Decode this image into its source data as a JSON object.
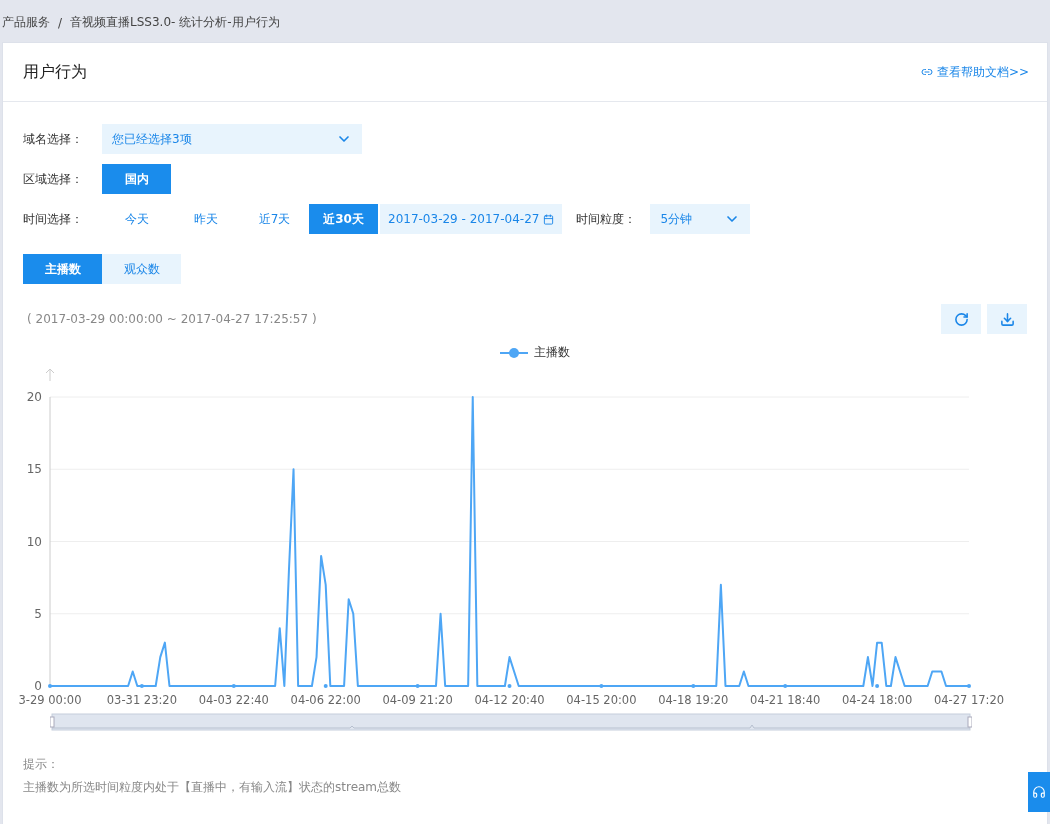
{
  "breadcrumb": {
    "items": [
      "产品服务",
      "音视频直播LSS3.0- 统计分析-用户行为"
    ],
    "separator": "/"
  },
  "title": "用户行为",
  "help_link": "查看帮助文档>>",
  "filters": {
    "domain": {
      "label": "域名选择：",
      "value": "您已经选择3项"
    },
    "region": {
      "label": "区域选择：",
      "options": [
        {
          "label": "国内",
          "selected": true
        }
      ]
    },
    "time": {
      "label": "时间选择：",
      "options": [
        {
          "label": "今天",
          "selected": false
        },
        {
          "label": "昨天",
          "selected": false
        },
        {
          "label": "近7天",
          "selected": false
        },
        {
          "label": "近30天",
          "selected": true
        }
      ],
      "date_range": "2017-03-29 - 2017-04-27"
    },
    "granularity": {
      "label": "时间粒度：",
      "value": "5分钟"
    }
  },
  "metric_tabs": [
    {
      "label": "主播数",
      "selected": true
    },
    {
      "label": "观众数",
      "selected": false
    }
  ],
  "range_text": "( 2017-03-29 00:00:00 ~ 2017-04-27 17:25:57 )",
  "chart_data": {
    "type": "line",
    "grid": true,
    "ylim": [
      0,
      20
    ],
    "yticks": [
      0,
      5,
      10,
      15,
      20
    ],
    "categories": [
      "3-29 00:00",
      null,
      null,
      null,
      null,
      null,
      null,
      null,
      null,
      null,
      null,
      null,
      null,
      null,
      null,
      null,
      null,
      null,
      null,
      null,
      "03-31 23:20",
      null,
      null,
      null,
      null,
      null,
      null,
      null,
      null,
      null,
      null,
      null,
      null,
      null,
      null,
      null,
      null,
      null,
      null,
      null,
      "04-03 22:40",
      null,
      null,
      null,
      null,
      null,
      null,
      null,
      null,
      null,
      null,
      null,
      null,
      null,
      null,
      null,
      null,
      null,
      null,
      null,
      "04-06 22:00",
      null,
      null,
      null,
      null,
      null,
      null,
      null,
      null,
      null,
      null,
      null,
      null,
      null,
      null,
      null,
      null,
      null,
      null,
      null,
      "04-09 21:20",
      null,
      null,
      null,
      null,
      null,
      null,
      null,
      null,
      null,
      null,
      null,
      null,
      null,
      null,
      null,
      null,
      null,
      null,
      null,
      "04-12 20:40",
      null,
      null,
      null,
      null,
      null,
      null,
      null,
      null,
      null,
      null,
      null,
      null,
      null,
      null,
      null,
      null,
      null,
      null,
      null,
      "04-15 20:00",
      null,
      null,
      null,
      null,
      null,
      null,
      null,
      null,
      null,
      null,
      null,
      null,
      null,
      null,
      null,
      null,
      null,
      null,
      null,
      "04-18 19:20",
      null,
      null,
      null,
      null,
      null,
      null,
      null,
      null,
      null,
      null,
      null,
      null,
      null,
      null,
      null,
      null,
      null,
      null,
      null,
      "04-21 18:40",
      null,
      null,
      null,
      null,
      null,
      null,
      null,
      null,
      null,
      null,
      null,
      null,
      null,
      null,
      null,
      null,
      null,
      null,
      null,
      "04-24 18:00",
      null,
      null,
      null,
      null,
      null,
      null,
      null,
      null,
      null,
      null,
      null,
      null,
      null,
      null,
      null,
      null,
      null,
      null,
      null,
      "04-27 17:20"
    ],
    "series": [
      {
        "name": "主播数",
        "color": "#4ea6f5",
        "values": [
          0,
          0,
          0,
          0,
          0,
          0,
          0,
          0,
          0,
          0,
          0,
          0,
          0,
          0,
          0,
          0,
          0,
          0,
          1,
          0,
          0,
          0,
          0,
          0,
          2,
          3,
          0,
          0,
          0,
          0,
          0,
          0,
          0,
          0,
          0,
          0,
          0,
          0,
          0,
          0,
          0,
          0,
          0,
          0,
          0,
          0,
          0,
          0,
          0,
          0,
          4,
          0,
          8,
          15,
          0,
          0,
          0,
          0,
          2,
          9,
          7,
          0,
          0,
          0,
          0,
          6,
          5,
          0,
          0,
          0,
          0,
          0,
          0,
          0,
          0,
          0,
          0,
          0,
          0,
          0,
          0,
          0,
          0,
          0,
          0,
          5,
          0,
          0,
          0,
          0,
          0,
          0,
          20,
          0,
          0,
          0,
          0,
          0,
          0,
          0,
          2,
          1,
          0,
          0,
          0,
          0,
          0,
          0,
          0,
          0,
          0,
          0,
          0,
          0,
          0,
          0,
          0,
          0,
          0,
          0,
          0,
          0,
          0,
          0,
          0,
          0,
          0,
          0,
          0,
          0,
          0,
          0,
          0,
          0,
          0,
          0,
          0,
          0,
          0,
          0,
          0,
          0,
          0,
          0,
          0,
          0,
          7,
          0,
          0,
          0,
          0,
          1,
          0,
          0,
          0,
          0,
          0,
          0,
          0,
          0,
          0,
          0,
          0,
          0,
          0,
          0,
          0,
          0,
          0,
          0,
          0,
          0,
          0,
          0,
          0,
          0,
          0,
          0,
          2,
          0,
          3,
          3,
          0,
          0,
          2,
          1,
          0,
          0,
          0,
          0,
          0,
          0,
          1,
          1,
          1,
          0,
          0,
          0,
          0,
          0,
          0
        ]
      }
    ]
  },
  "hint": {
    "title": "提示：",
    "text": "主播数为所选时间粒度内处于【直播中，有输入流】状态的stream总数"
  }
}
